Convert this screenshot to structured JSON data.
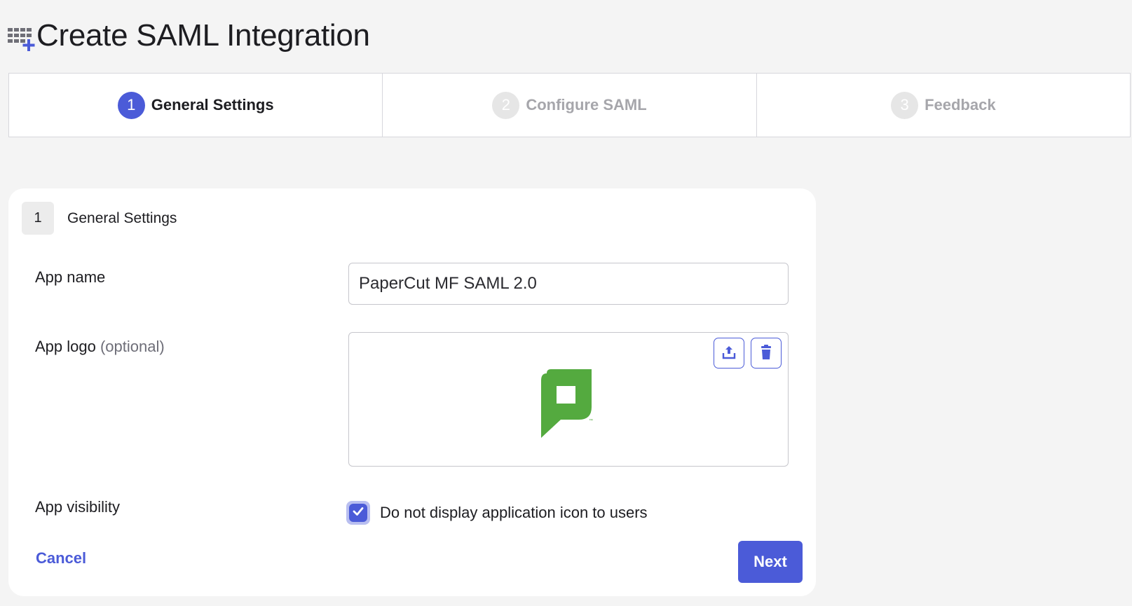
{
  "page": {
    "title": "Create SAML Integration",
    "header_icon": "grid-plus-icon"
  },
  "stepper": {
    "steps": [
      {
        "number": "1",
        "label": "General Settings",
        "state": "active"
      },
      {
        "number": "2",
        "label": "Configure SAML",
        "state": "inactive"
      },
      {
        "number": "3",
        "label": "Feedback",
        "state": "inactive"
      }
    ]
  },
  "section": {
    "number": "1",
    "title": "General Settings"
  },
  "form": {
    "app_name_label": "App name",
    "app_name_value": "PaperCut MF SAML 2.0",
    "app_logo_label": "App logo",
    "app_logo_optional": "(optional)",
    "upload_icon": "upload-icon",
    "delete_icon": "trash-icon",
    "app_visibility_label": "App visibility",
    "hide_icon_checkbox_label": "Do not display application icon to users",
    "hide_icon_checked": true
  },
  "actions": {
    "cancel_label": "Cancel",
    "next_label": "Next"
  },
  "colors": {
    "accent": "#4b5bd8",
    "logo_green": "#54aa3f",
    "background": "#f4f4f4"
  }
}
